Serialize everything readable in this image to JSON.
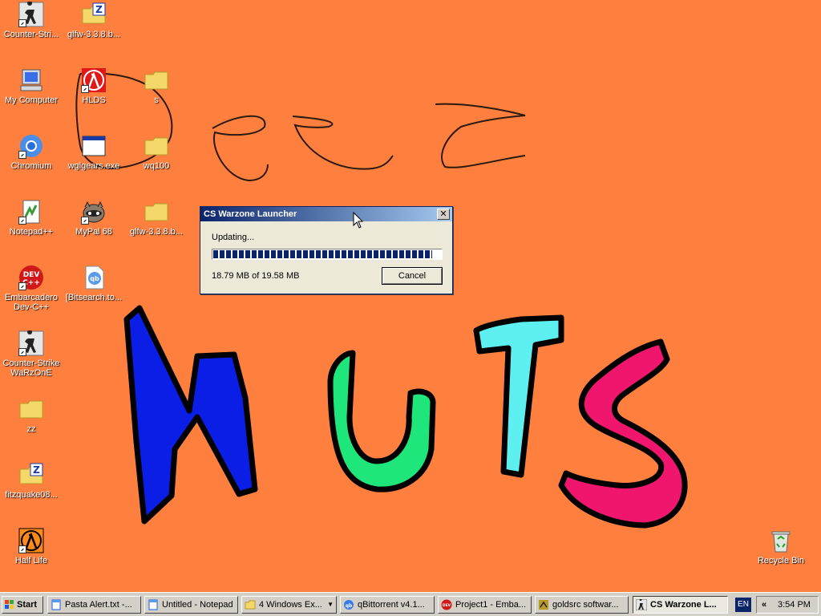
{
  "desktop": {
    "icons": {
      "cs": "Counter-Stri...",
      "glfw1": "glfw-3.3.8.b...",
      "mycomputer": "My Computer",
      "hlds": "HLDS",
      "s": "s",
      "chromium": "Chromium",
      "wglgears": "wglgears.exe",
      "wq100": "wq100",
      "notepadpp": "Notepad++",
      "mypal": "MyPal 68",
      "glfw2": "glfw-3.3.8.b...",
      "devcpp": "Embarcadero Dev-C++",
      "bitsearch": "[Bitsearch.to...",
      "cswarzone": "Counter-Strike WaRzOnE",
      "zz": "zz",
      "fitzquake": "fitzquake08...",
      "halflife": "Half Life",
      "recycle": "Recycle Bin"
    }
  },
  "dialog": {
    "title": "CS Warzone Launcher",
    "close_label": "✕",
    "status": "Updating...",
    "progress_fraction": 0.96,
    "size_text": "18.79 MB of 19.58 MB",
    "cancel_label": "Cancel"
  },
  "taskbar": {
    "start_label": "Start",
    "tasks": [
      {
        "label": "Pasta Alert.txt -..."
      },
      {
        "label": "Untitled - Notepad"
      },
      {
        "label": "4 Windows Ex..."
      },
      {
        "label": "qBittorrent v4.1..."
      },
      {
        "label": "Project1 - Emba..."
      },
      {
        "label": "goldsrc softwar..."
      },
      {
        "label": "CS Warzone L..."
      }
    ],
    "language": "EN",
    "tray_chevron": "«",
    "clock": "3:54 PM"
  },
  "colors": {
    "desktop_bg": "#ff7f3f",
    "n_letter": "#0a1ee6",
    "u_letter": "#1ee67a",
    "t_letter": "#5ef0f0",
    "s_letter": "#f0166e"
  }
}
